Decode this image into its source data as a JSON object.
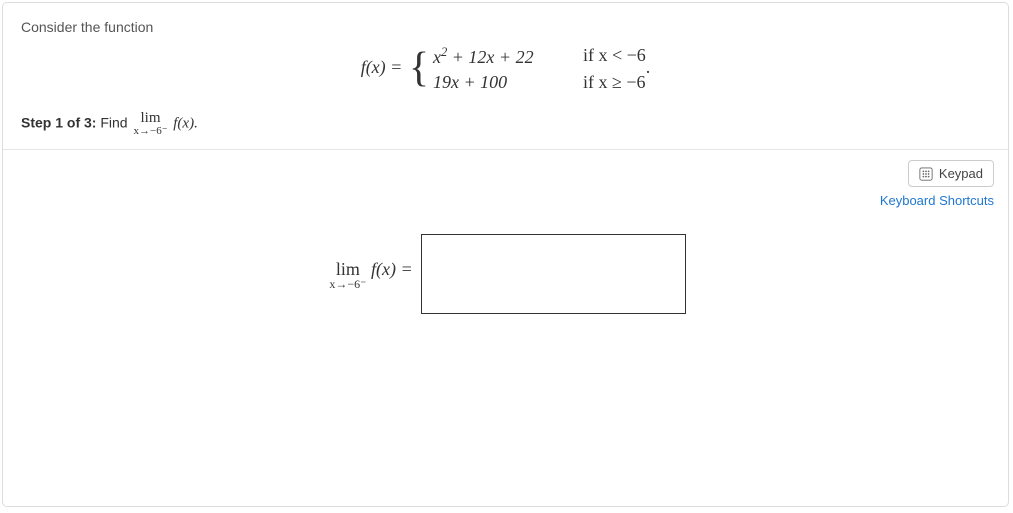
{
  "prompt": "Consider the function",
  "func": {
    "lhs": "f(x) = ",
    "case1_expr_html": "x<sup>2</sup> + 12x + 22",
    "case1_cond": "if x < −6",
    "case2_expr": "19x + 100",
    "case2_cond": "if x ≥ −6",
    "trail": "."
  },
  "step": {
    "label": "Step 1 of 3:",
    "text": " Find ",
    "lim_top": "lim",
    "lim_bot": "x→−6⁻",
    "after": " f(x).",
    "eq": " f(x) ="
  },
  "tools": {
    "keypad_label": "Keypad",
    "shortcuts_label": "Keyboard Shortcuts"
  },
  "answer_value": ""
}
